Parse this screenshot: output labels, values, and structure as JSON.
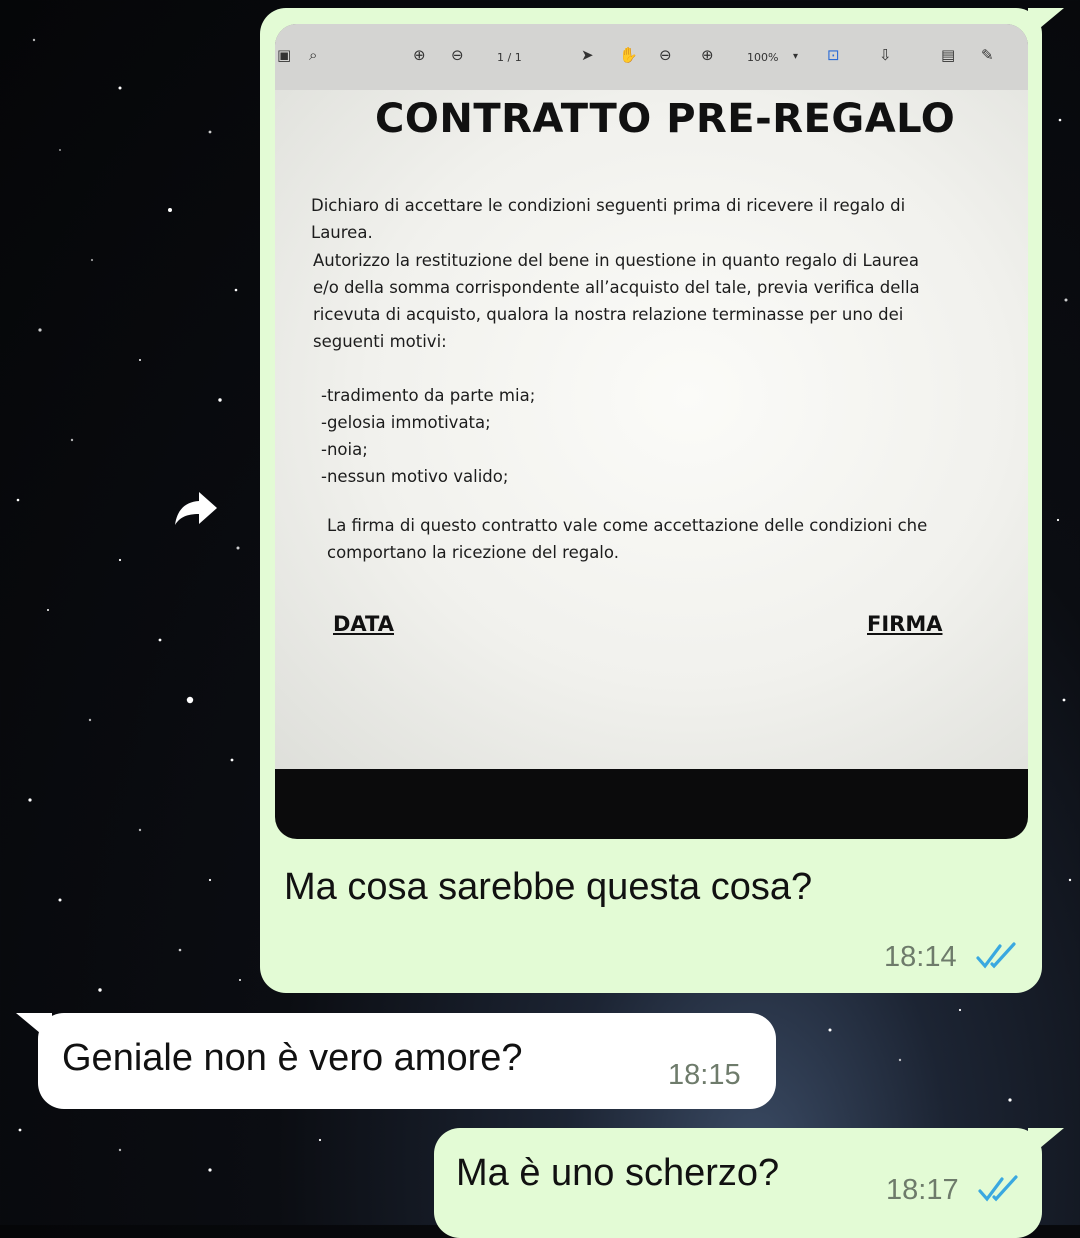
{
  "messages": [
    {
      "direction": "outgoing",
      "attachment": {
        "pdf_viewer": {
          "page_indicator": "1 / 1",
          "zoom": "100%"
        },
        "document": {
          "title": "CONTRATTO PRE-REGALO",
          "p1_line1": "Dichiaro di accettare le condizioni seguenti prima di ricevere il regalo di",
          "p1_line2": "Laurea.",
          "p2_line1": "Autorizzo la restituzione del bene in questione in quanto regalo di Laurea",
          "p2_line2": "e/o della somma corrispondente all’acquisto del tale, previa verifica della",
          "p2_line3": "ricevuta di acquisto, qualora la nostra relazione terminasse per uno dei",
          "p2_line4": "seguenti motivi:",
          "list": [
            "-tradimento da parte mia;",
            "-gelosia immotivata;",
            "-noia;",
            "-nessun motivo valido;"
          ],
          "p3_line1": "La firma di questo contratto vale come accettazione delle condizioni che",
          "p3_line2": "comportano la ricezione del regalo.",
          "label_date": "DATA",
          "label_signature": "FIRMA"
        }
      },
      "text": "Ma cosa sarebbe questa cosa?",
      "time": "18:14",
      "status": "read"
    },
    {
      "direction": "incoming",
      "text": "Geniale non è vero amore?",
      "time": "18:15"
    },
    {
      "direction": "outgoing",
      "text": "Ma è uno scherzo?",
      "time": "18:17",
      "status": "read"
    }
  ],
  "colors": {
    "outgoing_bubble": "#e3fbd5",
    "incoming_bubble": "#ffffff",
    "read_ticks": "#3aa8e0",
    "timestamp": "#6e7b6b"
  },
  "icons": [
    "forward-icon",
    "double-check-icon"
  ]
}
